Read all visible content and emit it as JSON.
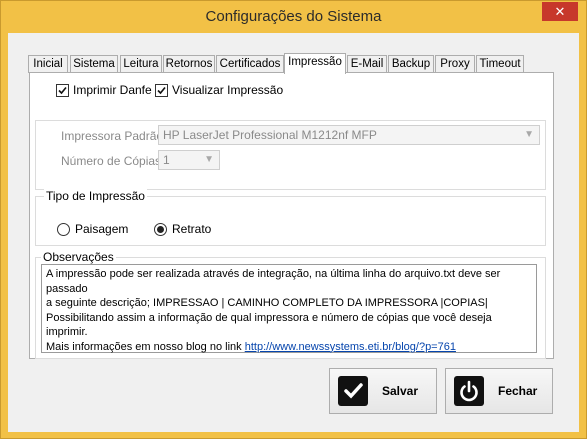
{
  "window": {
    "title": "Configurações do Sistema",
    "close_glyph": "✕"
  },
  "tabs": [
    {
      "label": "Inicial"
    },
    {
      "label": "Sistema"
    },
    {
      "label": "Leitura"
    },
    {
      "label": "Retornos"
    },
    {
      "label": "Certificados"
    },
    {
      "label": "Impressão",
      "active": true
    },
    {
      "label": "E-Mail"
    },
    {
      "label": "Backup"
    },
    {
      "label": "Proxy"
    },
    {
      "label": "Timeout"
    }
  ],
  "print": {
    "imprimir_danfe": {
      "label": "Imprimir Danfe",
      "checked": true
    },
    "visualizar": {
      "label": "Visualizar Impressão",
      "checked": true
    },
    "printer_label": "Impressora Padrão",
    "printer_value": "HP LaserJet Professional M1212nf MFP",
    "copies_label": "Número de Cópias",
    "copies_value": "1"
  },
  "tipo": {
    "title": "Tipo de Impressão",
    "paisagem": "Paisagem",
    "retrato": "Retrato",
    "selected": "Retrato"
  },
  "obs": {
    "title": "Observações",
    "line1": "A impressão pode ser realizada através de integração, na última linha do arquivo.txt deve ser passado",
    "line2": "a seguinte descrição; IMPRESSAO | CAMINHO COMPLETO DA IMPRESSORA |COPIAS|",
    "line3": "Possibilitando assim a informação de qual impressora e número de cópias que você deseja imprimir.",
    "line4_prefix": "Mais informações em nosso blog no link ",
    "link": "http://www.newssystems.eti.br/blog/?p=761"
  },
  "buttons": {
    "save": "Salvar",
    "close": "Fechar"
  },
  "colors": {
    "titlebar": "#f2c146",
    "close": "#c7382b",
    "link": "#0645ad"
  },
  "icons": {
    "save": "checkmark-icon",
    "close": "power-icon"
  }
}
